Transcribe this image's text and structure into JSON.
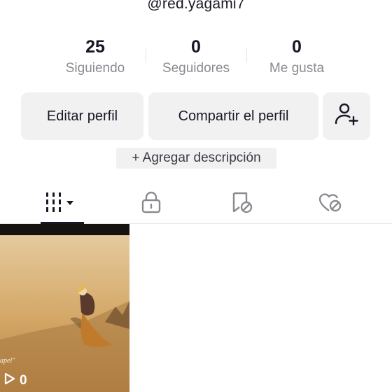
{
  "profile": {
    "username": "@red.yagami7"
  },
  "stats": [
    {
      "value": "25",
      "label": "Siguiendo"
    },
    {
      "value": "0",
      "label": "Seguidores"
    },
    {
      "value": "0",
      "label": "Me gusta"
    }
  ],
  "actions": {
    "edit_label": "Editar perfil",
    "share_label": "Compartir el perfil",
    "add_friend_icon": "person-add-icon"
  },
  "description": {
    "label": "+ Agregar descripción"
  },
  "tabs": [
    {
      "icon": "grid-icon",
      "active": true
    },
    {
      "icon": "lock-icon",
      "active": false
    },
    {
      "icon": "bookmark-hidden-icon",
      "active": false
    },
    {
      "icon": "heart-hidden-icon",
      "active": false
    }
  ],
  "videos": [
    {
      "views": "0",
      "caption_fragment": "apel\""
    }
  ],
  "colors": {
    "text_primary": "#161823",
    "text_secondary": "#8a8b91",
    "button_bg": "#f1f1f2"
  }
}
